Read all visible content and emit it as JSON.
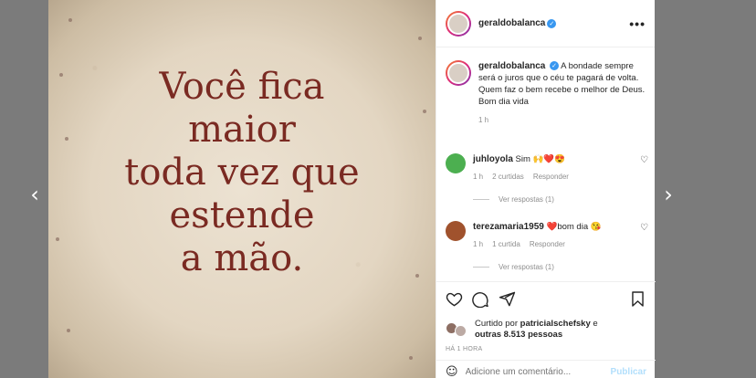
{
  "nav": {
    "prev_icon": "‹",
    "next_icon": "›"
  },
  "post": {
    "quote_lines": [
      "Você fica",
      "maior",
      "toda vez que",
      "estende",
      "a mão."
    ]
  },
  "header": {
    "username": "geraldobalanca",
    "more_icon": "•••"
  },
  "caption": {
    "username": "geraldobalanca",
    "text": "A bondade sempre será o juros que o céu te pagará de volta. Quem faz o bem recebe o melhor de Deus. Bom dia vida",
    "time": "1 h"
  },
  "comments": [
    {
      "username": "juhloyola",
      "text": "Sim 🙌❤️😍",
      "time": "1 h",
      "likes": "2 curtidas",
      "reply": "Responder",
      "view_replies": "Ver respostas (1)",
      "avatar_color": "#4caf50"
    },
    {
      "username": "terezamaria1959",
      "text": "❤️bom dia 😘",
      "time": "1 h",
      "likes": "1 curtida",
      "reply": "Responder",
      "view_replies": "Ver respostas (1)",
      "avatar_color": "#a0522d"
    }
  ],
  "likes": {
    "prefix": "Curtido por",
    "user": "patricialschefsky",
    "suffix": "e",
    "others": "outras 8.513 pessoas"
  },
  "post_time": "HÁ 1 HORA",
  "add_comment": {
    "placeholder": "Adicione um comentário...",
    "publish": "Publicar"
  },
  "colors": {
    "verified": "#3897f0",
    "quote": "#7a2a22",
    "publish": "#b2dffc"
  }
}
